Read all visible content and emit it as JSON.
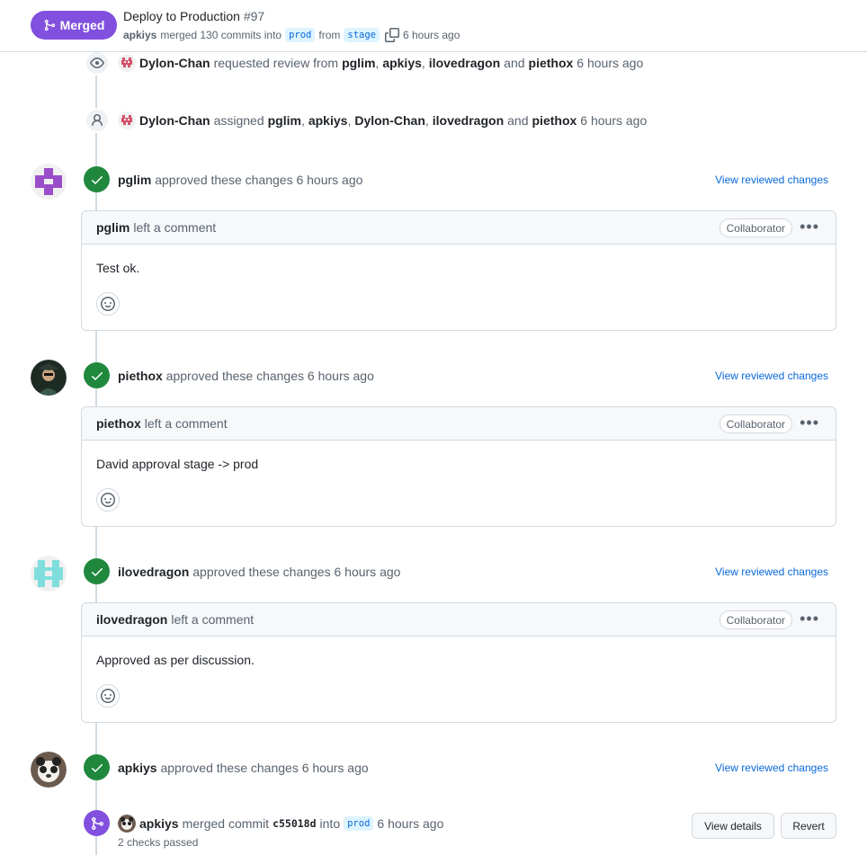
{
  "header": {
    "merged_label": "Merged",
    "title": "Deploy to Production",
    "number": "#97",
    "author": "apkiys",
    "merged_text": "merged 130 commits into",
    "base_branch": "prod",
    "from_text": "from",
    "head_branch": "stage",
    "time": "6 hours ago"
  },
  "events": {
    "review_request": {
      "actor": "Dylon-Chan",
      "action": "requested review from",
      "targets": [
        "pglim",
        "apkiys",
        "ilovedragon"
      ],
      "and_text": "and",
      "last_target": "piethox",
      "time": "6 hours ago"
    },
    "assigned": {
      "actor": "Dylon-Chan",
      "action": "assigned",
      "targets": [
        "pglim",
        "apkiys",
        "Dylon-Chan",
        "ilovedragon"
      ],
      "and_text": "and",
      "last_target": "piethox",
      "time": "6 hours ago"
    }
  },
  "reviews": [
    {
      "user": "pglim",
      "approved_text": "approved these changes",
      "time": "6 hours ago",
      "view_link": "View reviewed changes",
      "comment_action": "left a comment",
      "badge": "Collaborator",
      "body": "Test ok."
    },
    {
      "user": "piethox",
      "approved_text": "approved these changes",
      "time": "6 hours ago",
      "view_link": "View reviewed changes",
      "comment_action": "left a comment",
      "badge": "Collaborator",
      "body": "David approval stage -> prod"
    },
    {
      "user": "ilovedragon",
      "approved_text": "approved these changes",
      "time": "6 hours ago",
      "view_link": "View reviewed changes",
      "comment_action": "left a comment",
      "badge": "Collaborator",
      "body": "Approved as per discussion."
    },
    {
      "user": "apkiys",
      "approved_text": "approved these changes",
      "time": "6 hours ago",
      "view_link": "View reviewed changes"
    }
  ],
  "merge_event": {
    "actor": "apkiys",
    "action": "merged commit",
    "commit": "c55018d",
    "into_text": "into",
    "branch": "prod",
    "time": "6 hours ago",
    "checks": "2 checks passed",
    "view_details": "View details",
    "revert": "Revert"
  },
  "colors": {
    "merged_purple": "#8250df",
    "approved_green": "#1f883d",
    "link_blue": "#0969da"
  },
  "icons": {
    "merge": "git-merge-icon",
    "eye": "eye-icon",
    "person": "person-icon",
    "check": "check-icon",
    "copy": "copy-icon",
    "smiley": "smiley-icon",
    "kebab": "kebab-horizontal-icon"
  }
}
